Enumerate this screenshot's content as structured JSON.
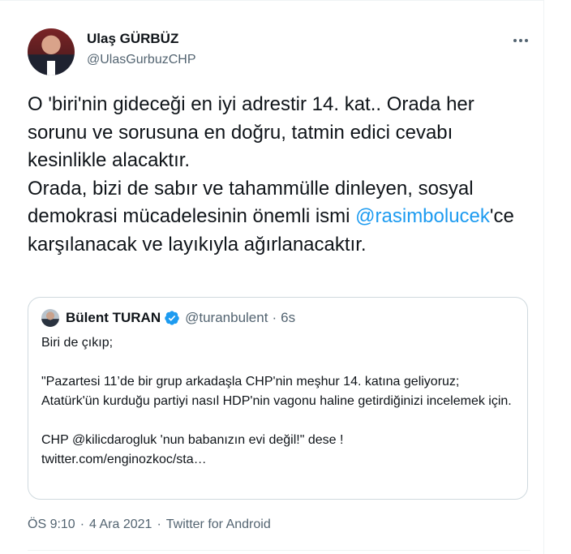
{
  "author": {
    "name": "Ulaş GÜRBÜZ",
    "handle": "@UlasGurbuzCHP"
  },
  "more_icon": "more-horizontal-icon",
  "tweet": {
    "line1": "O 'biri'nin gideceği en iyi adrestir 14. kat.. Orada her sorunu ve sorusuna en doğru, tatmin edici cevabı kesinlikle alacaktır.",
    "line2_prefix": "Orada, bizi de sabır ve tahammülle dinleyen, sosyal demokrasi mücadelesinin önemli ismi ",
    "mention": "@rasimbolucek",
    "line2_suffix": "'ce karşılanacak ve layıkıyla ağırlanacaktır."
  },
  "quote": {
    "name": "Bülent TURAN",
    "verified_icon": "verified-badge-icon",
    "handle": "@turanbulent",
    "dot": "·",
    "time": "6s",
    "p1": "Biri de çıkıp;",
    "p2": "\"Pazartesi 11’de bir grup arkadaşla CHP'nin meşhur 14. katına geliyoruz; Atatürk'ün kurduğu partiyi nasıl HDP'nin vagonu haline getirdiğinizi incelemek için.",
    "p3": "CHP @kilicdarogluk 'nun babanızın evi değil!\" dese !",
    "p4": "twitter.com/enginozkoc/sta…"
  },
  "meta": {
    "time": "ÖS 9:10",
    "sep1": "·",
    "date": "4 Ara 2021",
    "sep2": "·",
    "source": "Twitter for Android"
  },
  "colors": {
    "link": "#1d9bf0",
    "secondary_text": "#536471",
    "border": "#cfd9de"
  }
}
